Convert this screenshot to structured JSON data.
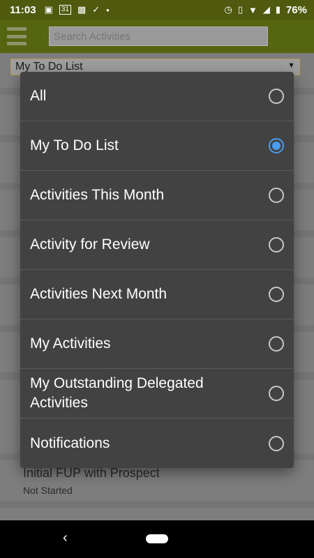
{
  "status_bar": {
    "time": "11:03",
    "left_icons": [
      "image-icon",
      "calendar-icon",
      "app-icon",
      "check-icon",
      "dot-icon"
    ],
    "calendar_day": "31",
    "battery": "76%"
  },
  "header": {
    "search_placeholder": "Search Activities"
  },
  "filter": {
    "selected": "My To Do List"
  },
  "background_item": {
    "title": "Initial FUP with Prospect",
    "status": "Not Started"
  },
  "dialog": {
    "options": [
      {
        "label": "All",
        "checked": false
      },
      {
        "label": "My To Do List",
        "checked": true
      },
      {
        "label": "Activities This Month",
        "checked": false
      },
      {
        "label": "Activity for Review",
        "checked": false
      },
      {
        "label": "Activities Next Month",
        "checked": false
      },
      {
        "label": "My Activities",
        "checked": false
      },
      {
        "label": "My Outstanding Delegated Activities",
        "checked": false
      },
      {
        "label": "Notifications",
        "checked": false
      }
    ]
  },
  "nav": {
    "back_glyph": "‹"
  },
  "colors": {
    "accent": "#4a9cf0",
    "header_bg": "#56650f",
    "dialog_bg": "#424242"
  }
}
